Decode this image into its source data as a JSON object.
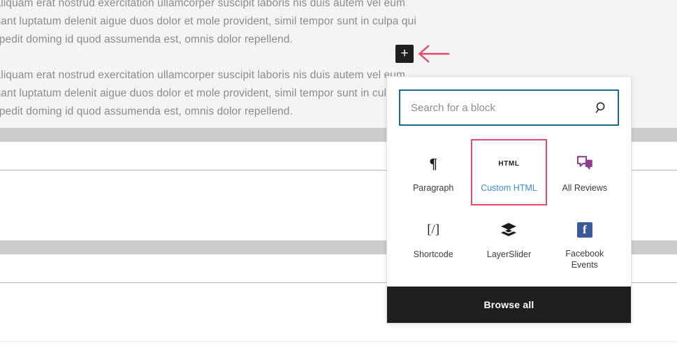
{
  "canvas": {
    "paragraph_blocks": [
      {
        "lines": [
          "gna aliquam erat nostrud exercitation ullamcorper suscipit laboris nis duis autem vel eum",
          "praesant luptatum delenit aigue duos dolor et mole provident, simil tempor sunt in culpa qui",
          "hil impedit doming id quod assumenda est, omnis dolor repellend."
        ]
      },
      {
        "lines": [
          "gna aliquam erat nostrud exercitation ullamcorper suscipit laboris nis duis autem vel eum",
          "praesant luptatum delenit aigue duos dolor et mole provident, simil tempor sunt in culpa qui",
          "hil impedit doming id quod assumenda est, omnis dolor repellend."
        ]
      }
    ]
  },
  "toolbar": {
    "add_block_label": "+",
    "add_block_name": "add-block-button"
  },
  "annotation": {
    "arrow_color": "#e8486f",
    "arrow_direction": "left"
  },
  "inserter": {
    "search": {
      "placeholder": "Search for a block",
      "value": "",
      "icon": "search-icon",
      "border_color": "#1a6c8b"
    },
    "blocks": [
      {
        "label": "Paragraph",
        "icon": "pilcrow-icon",
        "glyph": "¶",
        "selected": false
      },
      {
        "label": "Custom HTML",
        "icon": "html-icon",
        "glyph": "HTML",
        "selected": true
      },
      {
        "label": "All Reviews",
        "icon": "speech-bubbles-icon",
        "glyph": "",
        "selected": false
      },
      {
        "label": "Shortcode",
        "icon": "shortcode-icon",
        "glyph": "[/]",
        "selected": false
      },
      {
        "label": "LayerSlider",
        "icon": "layers-icon",
        "glyph": "",
        "selected": false
      },
      {
        "label": "Facebook Events",
        "icon": "facebook-icon",
        "glyph": "f",
        "selected": false
      }
    ],
    "selected_border_color": "#e8486f",
    "selected_label_color": "#3a8fc4",
    "browse_all_label": "Browse all"
  }
}
